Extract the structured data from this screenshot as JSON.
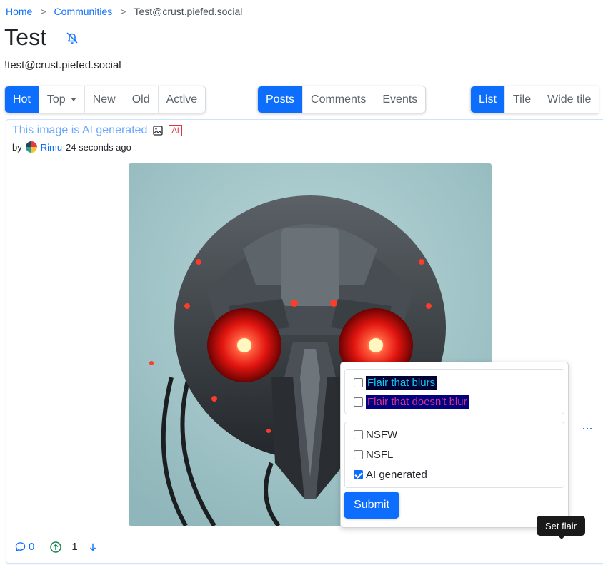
{
  "breadcrumb": {
    "home": "Home",
    "communities": "Communities",
    "current": "Test@crust.piefed.social",
    "separator": ">"
  },
  "community": {
    "title": "Test",
    "handle": "!test@crust.piefed.social",
    "notification_icon": "bell-slash-icon"
  },
  "sort_options": {
    "items": [
      "Hot",
      "Top",
      "New",
      "Old",
      "Active"
    ],
    "active": "Hot"
  },
  "content_types": {
    "items": [
      "Posts",
      "Comments",
      "Events"
    ],
    "active": "Posts"
  },
  "layouts": {
    "items": [
      "List",
      "Tile",
      "Wide tile"
    ],
    "active": "List"
  },
  "post": {
    "title": "This image is AI generated",
    "type_icon": "image-icon",
    "ai_badge": "AI",
    "by_label": "by",
    "author": "Rimu",
    "time": "24 seconds ago",
    "image_description_icon": "robot-portrait-image",
    "reply_count": "0",
    "score": "1"
  },
  "flair_form": {
    "community_flairs": [
      {
        "label": "Flair that blurs",
        "checked": false,
        "text_color": "#0dcaf0",
        "bg_color": "#000033"
      },
      {
        "label": "Flair that doesn't blur",
        "checked": false,
        "text_color": "#d63384",
        "bg_color": "#000080"
      }
    ],
    "content_flags": [
      {
        "label": "NSFW",
        "checked": false
      },
      {
        "label": "NSFL",
        "checked": false
      },
      {
        "label": "AI generated",
        "checked": true
      }
    ],
    "submit_label": "Submit"
  },
  "tooltip": {
    "text": "Set flair"
  },
  "colors": {
    "accent": "#0d6efd",
    "title_link": "#6ea8fe",
    "badge_red": "#dc3545"
  }
}
